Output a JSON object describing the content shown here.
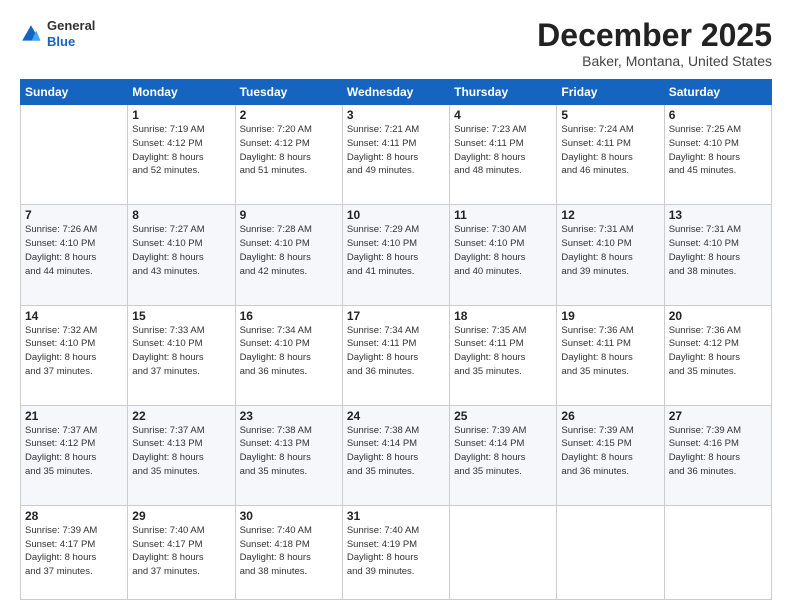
{
  "header": {
    "logo_line1": "General",
    "logo_line2": "Blue",
    "month": "December 2025",
    "location": "Baker, Montana, United States"
  },
  "weekdays": [
    "Sunday",
    "Monday",
    "Tuesday",
    "Wednesday",
    "Thursday",
    "Friday",
    "Saturday"
  ],
  "rows": [
    [
      {
        "day": "",
        "info": ""
      },
      {
        "day": "1",
        "info": "Sunrise: 7:19 AM\nSunset: 4:12 PM\nDaylight: 8 hours\nand 52 minutes."
      },
      {
        "day": "2",
        "info": "Sunrise: 7:20 AM\nSunset: 4:12 PM\nDaylight: 8 hours\nand 51 minutes."
      },
      {
        "day": "3",
        "info": "Sunrise: 7:21 AM\nSunset: 4:11 PM\nDaylight: 8 hours\nand 49 minutes."
      },
      {
        "day": "4",
        "info": "Sunrise: 7:23 AM\nSunset: 4:11 PM\nDaylight: 8 hours\nand 48 minutes."
      },
      {
        "day": "5",
        "info": "Sunrise: 7:24 AM\nSunset: 4:11 PM\nDaylight: 8 hours\nand 46 minutes."
      },
      {
        "day": "6",
        "info": "Sunrise: 7:25 AM\nSunset: 4:10 PM\nDaylight: 8 hours\nand 45 minutes."
      }
    ],
    [
      {
        "day": "7",
        "info": "Sunrise: 7:26 AM\nSunset: 4:10 PM\nDaylight: 8 hours\nand 44 minutes."
      },
      {
        "day": "8",
        "info": "Sunrise: 7:27 AM\nSunset: 4:10 PM\nDaylight: 8 hours\nand 43 minutes."
      },
      {
        "day": "9",
        "info": "Sunrise: 7:28 AM\nSunset: 4:10 PM\nDaylight: 8 hours\nand 42 minutes."
      },
      {
        "day": "10",
        "info": "Sunrise: 7:29 AM\nSunset: 4:10 PM\nDaylight: 8 hours\nand 41 minutes."
      },
      {
        "day": "11",
        "info": "Sunrise: 7:30 AM\nSunset: 4:10 PM\nDaylight: 8 hours\nand 40 minutes."
      },
      {
        "day": "12",
        "info": "Sunrise: 7:31 AM\nSunset: 4:10 PM\nDaylight: 8 hours\nand 39 minutes."
      },
      {
        "day": "13",
        "info": "Sunrise: 7:31 AM\nSunset: 4:10 PM\nDaylight: 8 hours\nand 38 minutes."
      }
    ],
    [
      {
        "day": "14",
        "info": "Sunrise: 7:32 AM\nSunset: 4:10 PM\nDaylight: 8 hours\nand 37 minutes."
      },
      {
        "day": "15",
        "info": "Sunrise: 7:33 AM\nSunset: 4:10 PM\nDaylight: 8 hours\nand 37 minutes."
      },
      {
        "day": "16",
        "info": "Sunrise: 7:34 AM\nSunset: 4:10 PM\nDaylight: 8 hours\nand 36 minutes."
      },
      {
        "day": "17",
        "info": "Sunrise: 7:34 AM\nSunset: 4:11 PM\nDaylight: 8 hours\nand 36 minutes."
      },
      {
        "day": "18",
        "info": "Sunrise: 7:35 AM\nSunset: 4:11 PM\nDaylight: 8 hours\nand 35 minutes."
      },
      {
        "day": "19",
        "info": "Sunrise: 7:36 AM\nSunset: 4:11 PM\nDaylight: 8 hours\nand 35 minutes."
      },
      {
        "day": "20",
        "info": "Sunrise: 7:36 AM\nSunset: 4:12 PM\nDaylight: 8 hours\nand 35 minutes."
      }
    ],
    [
      {
        "day": "21",
        "info": "Sunrise: 7:37 AM\nSunset: 4:12 PM\nDaylight: 8 hours\nand 35 minutes."
      },
      {
        "day": "22",
        "info": "Sunrise: 7:37 AM\nSunset: 4:13 PM\nDaylight: 8 hours\nand 35 minutes."
      },
      {
        "day": "23",
        "info": "Sunrise: 7:38 AM\nSunset: 4:13 PM\nDaylight: 8 hours\nand 35 minutes."
      },
      {
        "day": "24",
        "info": "Sunrise: 7:38 AM\nSunset: 4:14 PM\nDaylight: 8 hours\nand 35 minutes."
      },
      {
        "day": "25",
        "info": "Sunrise: 7:39 AM\nSunset: 4:14 PM\nDaylight: 8 hours\nand 35 minutes."
      },
      {
        "day": "26",
        "info": "Sunrise: 7:39 AM\nSunset: 4:15 PM\nDaylight: 8 hours\nand 36 minutes."
      },
      {
        "day": "27",
        "info": "Sunrise: 7:39 AM\nSunset: 4:16 PM\nDaylight: 8 hours\nand 36 minutes."
      }
    ],
    [
      {
        "day": "28",
        "info": "Sunrise: 7:39 AM\nSunset: 4:17 PM\nDaylight: 8 hours\nand 37 minutes."
      },
      {
        "day": "29",
        "info": "Sunrise: 7:40 AM\nSunset: 4:17 PM\nDaylight: 8 hours\nand 37 minutes."
      },
      {
        "day": "30",
        "info": "Sunrise: 7:40 AM\nSunset: 4:18 PM\nDaylight: 8 hours\nand 38 minutes."
      },
      {
        "day": "31",
        "info": "Sunrise: 7:40 AM\nSunset: 4:19 PM\nDaylight: 8 hours\nand 39 minutes."
      },
      {
        "day": "",
        "info": ""
      },
      {
        "day": "",
        "info": ""
      },
      {
        "day": "",
        "info": ""
      }
    ]
  ]
}
